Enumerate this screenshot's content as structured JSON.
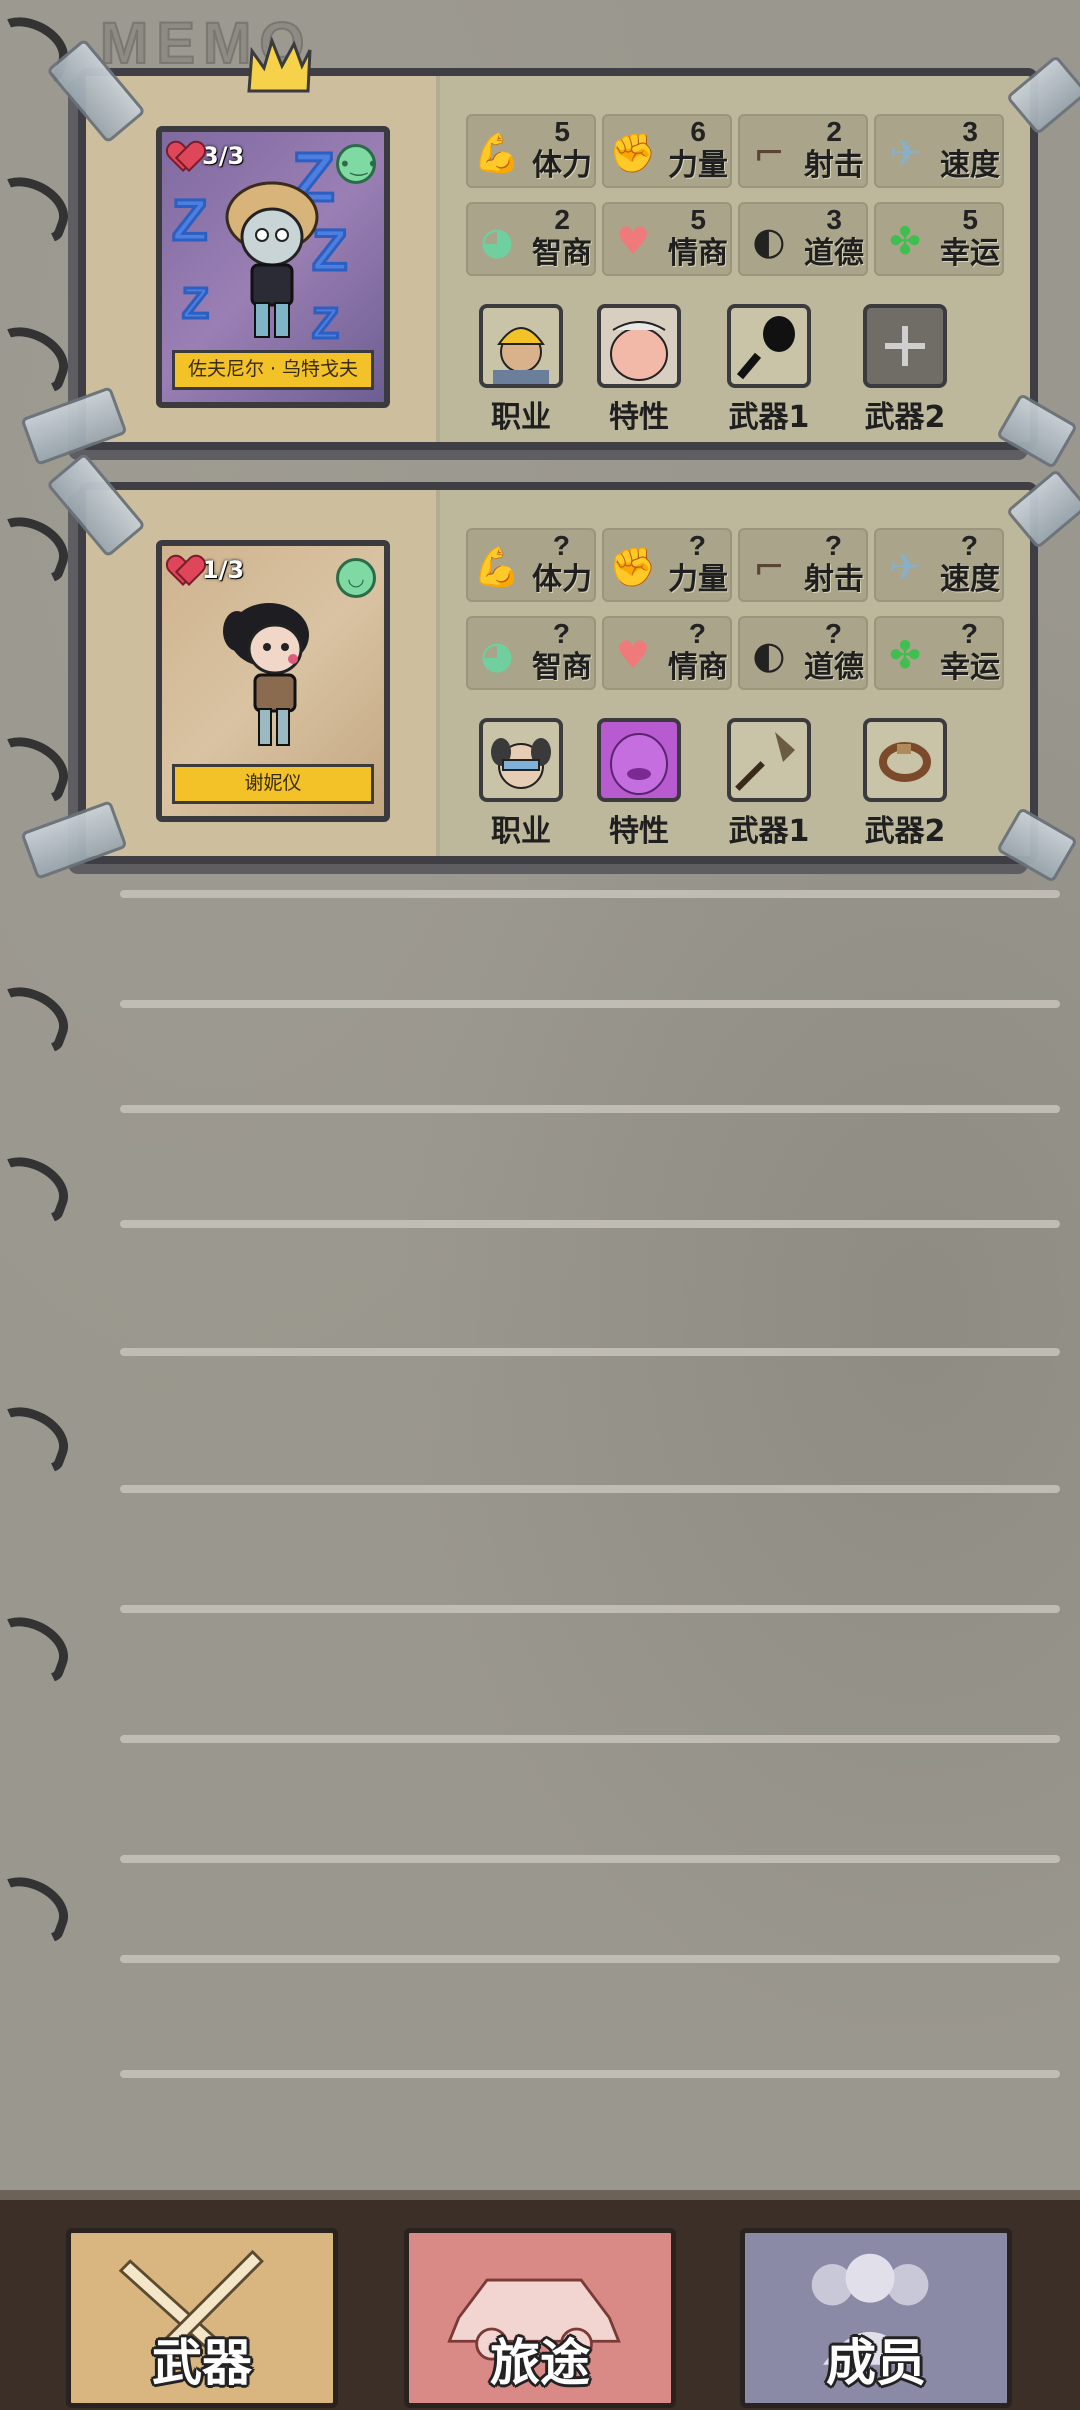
{
  "background": {
    "title": "MEMO"
  },
  "members": [
    {
      "hp": "3/3",
      "name": "佐夫尼尔 · 乌特戈夫",
      "mood": "neutral-face-icon",
      "stats": [
        {
          "icon": "muscle-icon",
          "value": "5",
          "label": "体力"
        },
        {
          "icon": "arm-icon",
          "value": "6",
          "label": "力量"
        },
        {
          "icon": "pistol-icon",
          "value": "2",
          "label": "射击"
        },
        {
          "icon": "winged-boot-icon",
          "value": "3",
          "label": "速度"
        },
        {
          "icon": "brain-icon",
          "value": "2",
          "label": "智商"
        },
        {
          "icon": "heart-bubble-icon",
          "value": "5",
          "label": "情商"
        },
        {
          "icon": "mask-icon",
          "value": "3",
          "label": "道德"
        },
        {
          "icon": "clover-icon",
          "value": "5",
          "label": "幸运"
        }
      ],
      "equipment": [
        {
          "label": "职业"
        },
        {
          "label": "特性"
        },
        {
          "label": "武器1"
        },
        {
          "label": "武器2"
        }
      ]
    },
    {
      "hp": "1/3",
      "name": "谢妮仪",
      "mood": "smiling-face-icon",
      "stats": [
        {
          "icon": "muscle-icon",
          "value": "?",
          "label": "体力"
        },
        {
          "icon": "arm-icon",
          "value": "?",
          "label": "力量"
        },
        {
          "icon": "pistol-icon",
          "value": "?",
          "label": "射击"
        },
        {
          "icon": "winged-boot-icon",
          "value": "?",
          "label": "速度"
        },
        {
          "icon": "brain-icon",
          "value": "?",
          "label": "智商"
        },
        {
          "icon": "heart-bubble-icon",
          "value": "?",
          "label": "情商"
        },
        {
          "icon": "mask-icon",
          "value": "?",
          "label": "道德"
        },
        {
          "icon": "clover-icon",
          "value": "?",
          "label": "幸运"
        }
      ],
      "equipment": [
        {
          "label": "职业"
        },
        {
          "label": "特性"
        },
        {
          "label": "武器1"
        },
        {
          "label": "武器2"
        }
      ]
    }
  ],
  "tabs": [
    {
      "label": "武器",
      "color": "#d9b57f"
    },
    {
      "label": "旅途",
      "color": "#d98a86"
    },
    {
      "label": "成员",
      "color": "#8b8aa6"
    }
  ]
}
